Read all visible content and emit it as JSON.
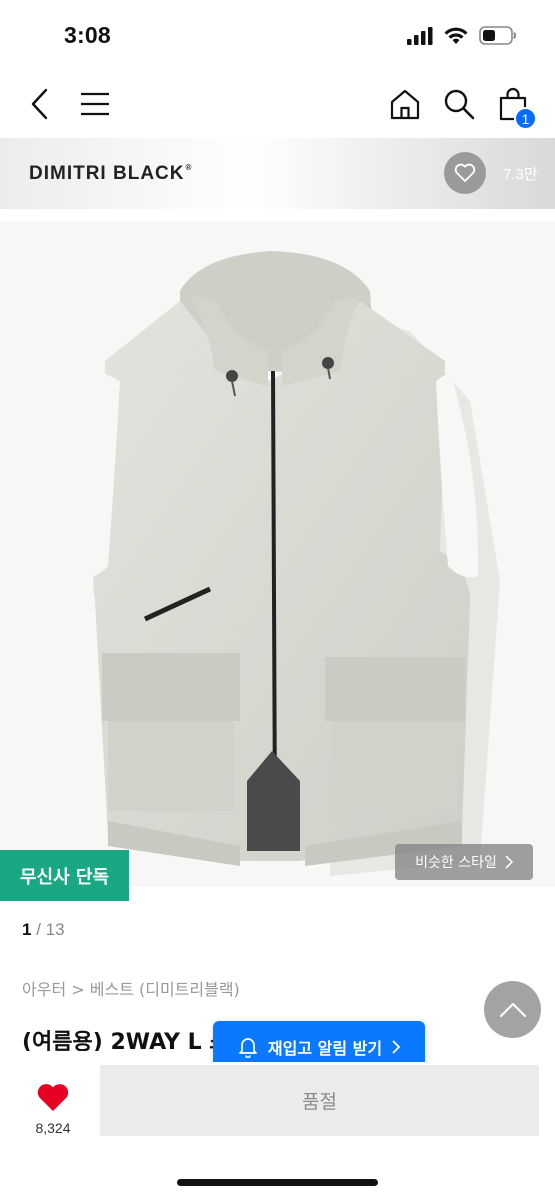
{
  "status": {
    "time": "3:08"
  },
  "nav": {
    "back_icon": "chevron-left-icon",
    "menu_icon": "hamburger-menu-icon",
    "home_icon": "home-icon",
    "search_icon": "search-icon",
    "cart_icon": "shopping-bag-icon",
    "cart_count": "1"
  },
  "brand": {
    "name": "DIMITRI BLACK",
    "reg_mark": "®",
    "like_count": "7.3만"
  },
  "image": {
    "exclusive_badge": "무신사 단독",
    "similar_style": "비슷한 스타일",
    "current_page": "1",
    "page_separator": "/",
    "total_pages": "13"
  },
  "product": {
    "breadcrumb": "아우터 > 베스트 (디미트리블랙)",
    "title": "(여름용) 2WAY L        스트 크림"
  },
  "restock": {
    "label": "재입고 알림 받기"
  },
  "bottom": {
    "heart_count": "8,324",
    "soldout_label": "품절"
  },
  "colors": {
    "accent_blue": "#0a78ff",
    "exclusive_green": "#1aa783",
    "heart_red": "#e60022"
  }
}
